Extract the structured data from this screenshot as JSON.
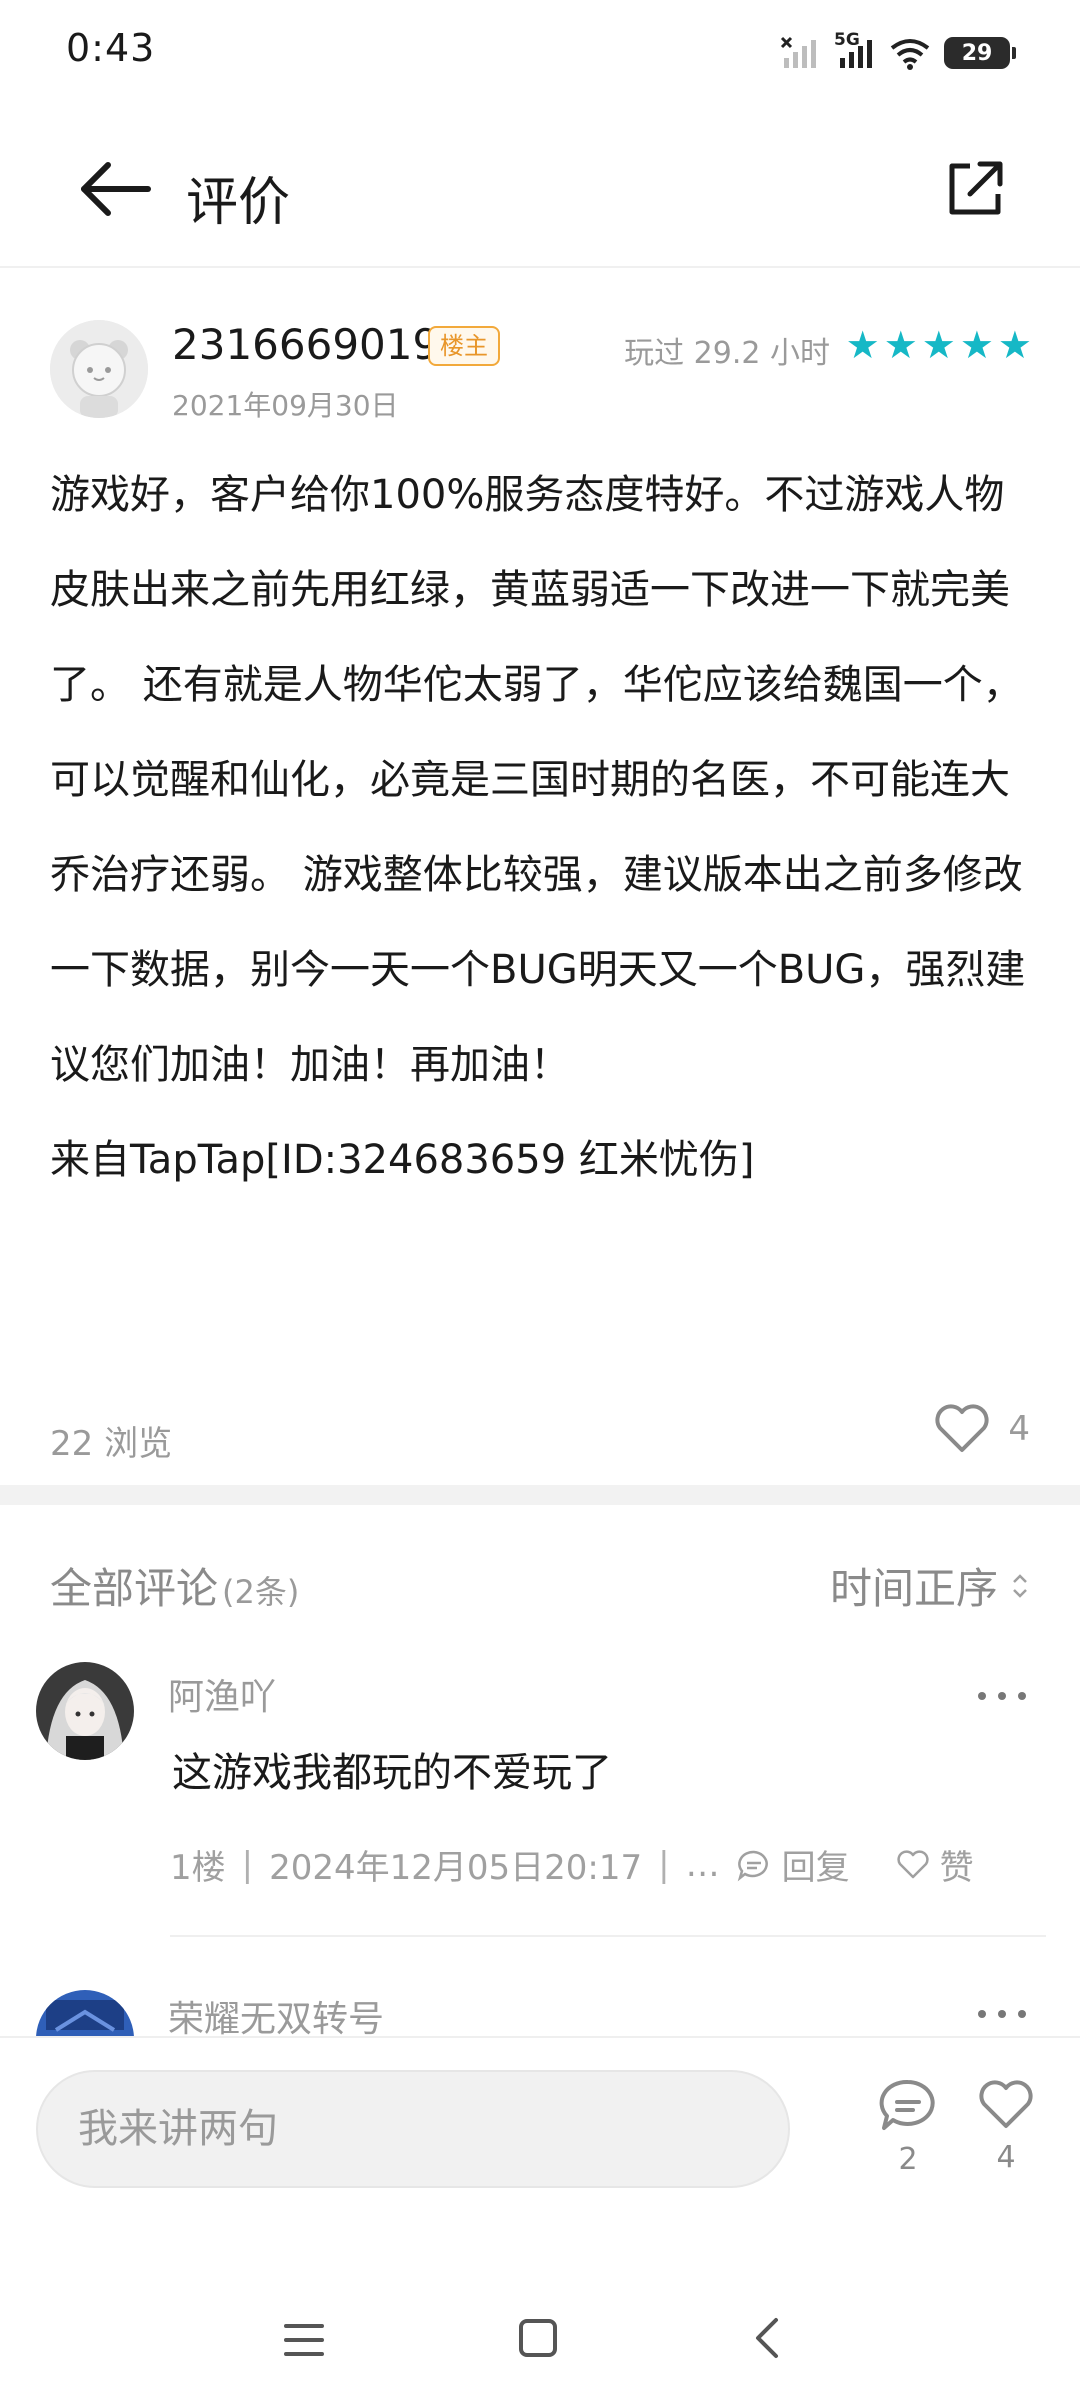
{
  "status_bar": {
    "time": "0:43",
    "network": "5G",
    "battery": "29"
  },
  "header": {
    "title": "评价"
  },
  "review": {
    "username": "2316669019",
    "owner_badge": "楼主",
    "date": "2021年09月30日",
    "playtime": "玩过 29.2 小时",
    "stars": 5,
    "star_color": "#16b8c6",
    "body": "游戏好，客户给你100%服务态度特好。不过游戏人物皮肤出来之前先用红绿，黄蓝弱适一下改进一下就完美了。 还有就是人物华佗太弱了，华佗应该给魏国一个，可以觉醒和仙化，必竟是三国时期的名医，不可能连大乔治疗还弱。 游戏整体比较强，建议版本出之前多修改一下数据，别今一天一个BUG明天又一个BUG，强烈建议您们加油！加油！再加油！",
    "source": "来自TapTap[ID:324683659 红米忧伤]",
    "views": "22 浏览",
    "likes": "4"
  },
  "comments_section": {
    "title": "全部评论",
    "count": "(2条)",
    "sort": "时间正序",
    "items": [
      {
        "name": "阿渔吖",
        "text": "这游戏我都玩的不爱玩了",
        "floor": "1楼",
        "time": "2024年12月05日20:17",
        "ellipsis": "…",
        "reply_label": "回复",
        "like_label": "赞"
      },
      {
        "name": "荣耀无双转号"
      }
    ]
  },
  "bottom_bar": {
    "input_placeholder": "我来讲两句",
    "comment_count": "2",
    "like_count": "4"
  },
  "colors": {
    "accent_teal": "#16b8c6",
    "badge_orange": "#e8962a",
    "muted_text": "#9a9a9a"
  }
}
